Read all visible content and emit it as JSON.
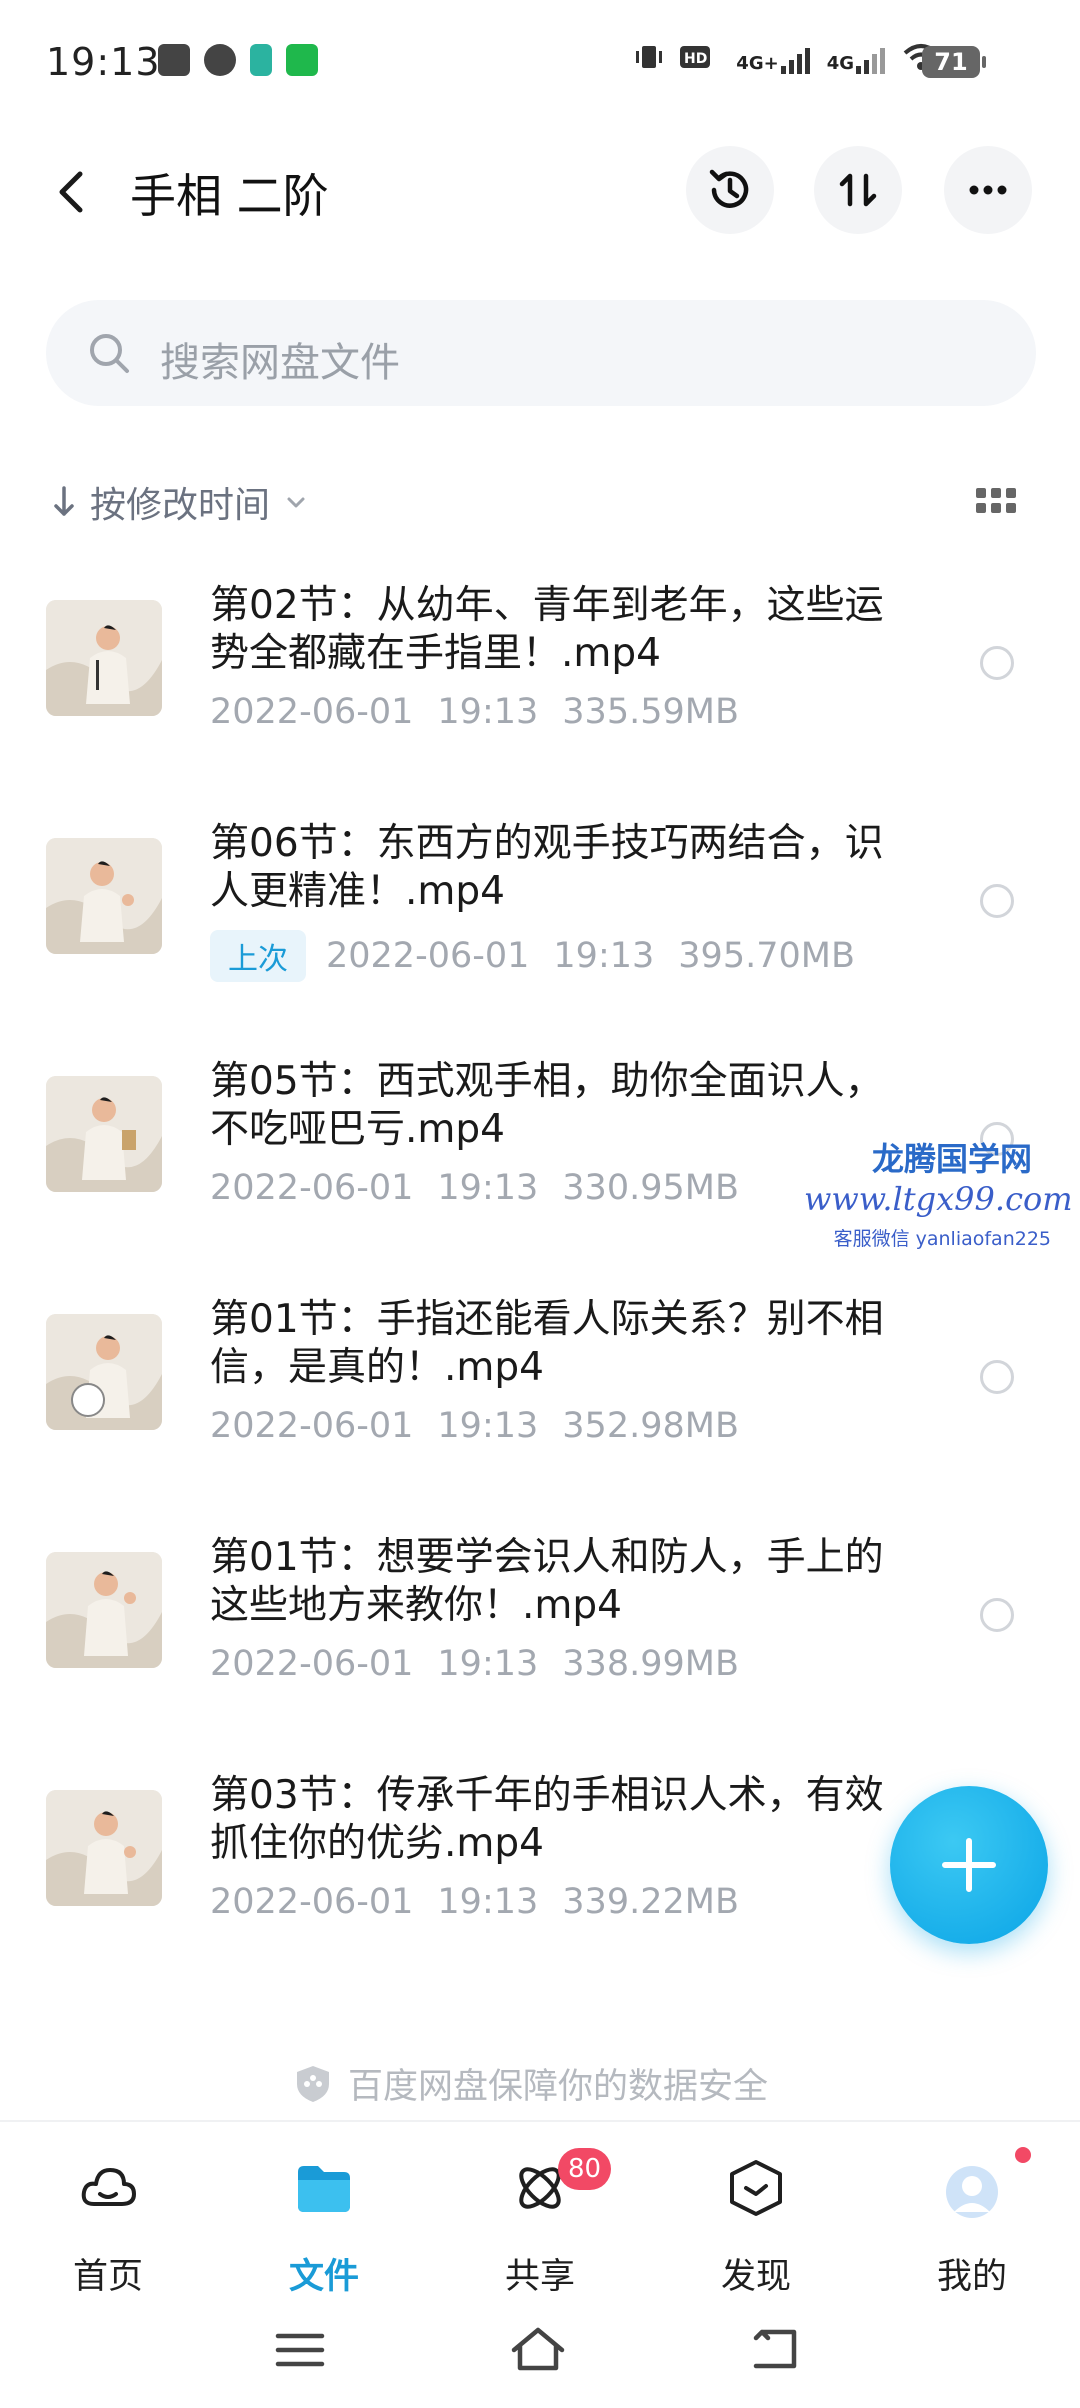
{
  "status_bar": {
    "time": "19:13",
    "network_1": "4G+",
    "network_2": "4G",
    "battery": "71"
  },
  "header": {
    "title": "手相 二阶"
  },
  "search": {
    "placeholder": "搜索网盘文件"
  },
  "sort": {
    "label": "按修改时间"
  },
  "files": [
    {
      "name": "第02节：从幼年、青年到老年，这些运势全都藏在手指里！.mp4",
      "date": "2022-06-01",
      "time": "19:13",
      "size": "335.59MB",
      "badge": ""
    },
    {
      "name": "第06节：东西方的观手技巧两结合，识人更精准！.mp4",
      "date": "2022-06-01",
      "time": "19:13",
      "size": "395.70MB",
      "badge": "上次"
    },
    {
      "name": "第05节：西式观手相，助你全面识人，不吃哑巴亏.mp4",
      "date": "2022-06-01",
      "time": "19:13",
      "size": "330.95MB",
      "badge": ""
    },
    {
      "name": "第01节：手指还能看人际关系？别不相信，是真的！.mp4",
      "date": "2022-06-01",
      "time": "19:13",
      "size": "352.98MB",
      "badge": ""
    },
    {
      "name": "第01节：想要学会识人和防人，手上的这些地方来教你！.mp4",
      "date": "2022-06-01",
      "time": "19:13",
      "size": "338.99MB",
      "badge": ""
    },
    {
      "name": "第03节：传承千年的手相识人术，有效抓住你的优劣.mp4",
      "date": "2022-06-01",
      "time": "19:13",
      "size": "339.22MB",
      "badge": ""
    }
  ],
  "watermark": {
    "line1": "龙腾国学网",
    "line2": "www.ltgx99.com",
    "line3": "客服微信 yanliaofan225"
  },
  "safety_note": "百度网盘保障你的数据安全",
  "bottom_nav": {
    "items": [
      {
        "label": "首页",
        "icon": "cloud-icon"
      },
      {
        "label": "文件",
        "icon": "folder-icon"
      },
      {
        "label": "共享",
        "icon": "share-atom-icon",
        "badge": "80"
      },
      {
        "label": "发现",
        "icon": "discover-box-icon"
      },
      {
        "label": "我的",
        "icon": "avatar-icon"
      }
    ]
  },
  "colors": {
    "accent": "#1a9bd7",
    "fab": "#0aa4e6",
    "badge_red": "#f24965"
  }
}
